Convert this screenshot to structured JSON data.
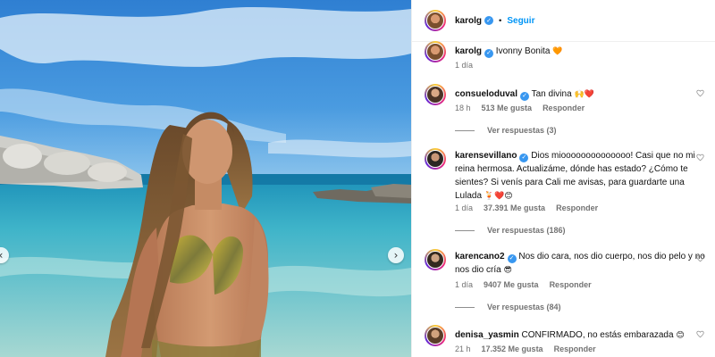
{
  "post": {
    "owner": "karolg",
    "follow_label": "Seguir",
    "separator": "•"
  },
  "caption": {
    "username": "karolg",
    "text": "Ivonny Bonita",
    "emoji": "🧡",
    "time": "1 día"
  },
  "comments": [
    {
      "username": "consueloduval",
      "verified": true,
      "text": "Tan divina",
      "emoji": "🙌❤️",
      "time": "18 h",
      "likes": "513 Me gusta",
      "reply": "Responder",
      "view_replies": "Ver respuestas (3)"
    },
    {
      "username": "karensevillano",
      "verified": true,
      "text": "Dios mioooooooooooooo! Casi que no mi reina hermosa. Actualizáme, dónde has estado? ¿Cómo te sientes? Si venís para Cali me avisas, para guardarte una Lulada",
      "emoji": "🍹❤️😊",
      "time": "1 día",
      "likes": "37.391 Me gusta",
      "reply": "Responder",
      "view_replies": "Ver respuestas (186)"
    },
    {
      "username": "karencano2",
      "verified": true,
      "text": "Nos dio cara, nos dio cuerpo, nos dio pelo y no nos dio cría",
      "emoji": "😎",
      "time": "1 día",
      "likes": "9407 Me gusta",
      "reply": "Responder",
      "view_replies": "Ver respuestas (84)"
    },
    {
      "username": "denisa_yasmin",
      "verified": false,
      "text": "CONFIRMADO, no estás embarazada",
      "emoji": "😊",
      "time": "21 h",
      "likes": "17.352 Me gusta",
      "reply": "Responder",
      "view_replies": ""
    }
  ],
  "icons": {
    "next": "chevron-right-icon",
    "prev": "chevron-left-icon",
    "heart": "heart-icon",
    "verified": "verified-badge-icon"
  },
  "colors": {
    "accent": "#0095f6",
    "verified": "#3897f0",
    "muted": "#737373"
  }
}
